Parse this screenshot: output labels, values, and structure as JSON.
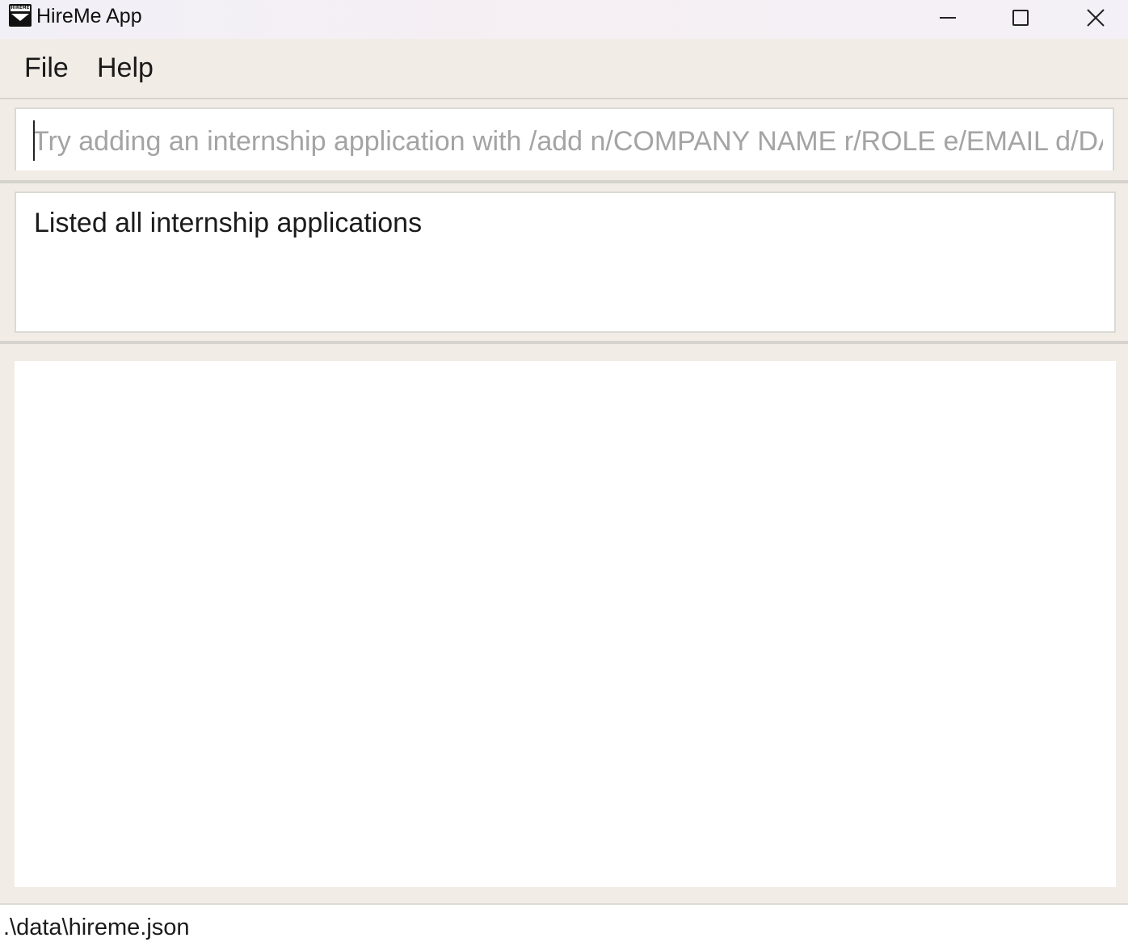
{
  "window": {
    "title": "HireMe App",
    "icon_label": "HIREME",
    "controls": {
      "minimize": "minimize-icon",
      "maximize": "maximize-icon",
      "close": "close-icon",
      "close_glyph": "✕"
    }
  },
  "menu": {
    "items": [
      {
        "label": "File"
      },
      {
        "label": "Help"
      }
    ]
  },
  "command_box": {
    "value": "",
    "placeholder": "Try adding an internship application with /add n/COMPANY NAME r/ROLE e/EMAIL d/DAT"
  },
  "result_display": {
    "text": "Listed all internship applications"
  },
  "application_list": {
    "items": []
  },
  "status_bar": {
    "file_path": ".\\data\\hireme.json"
  },
  "colors": {
    "background": "#f1ece6",
    "panel": "#ffffff",
    "placeholder_text": "#a4a4a4"
  }
}
